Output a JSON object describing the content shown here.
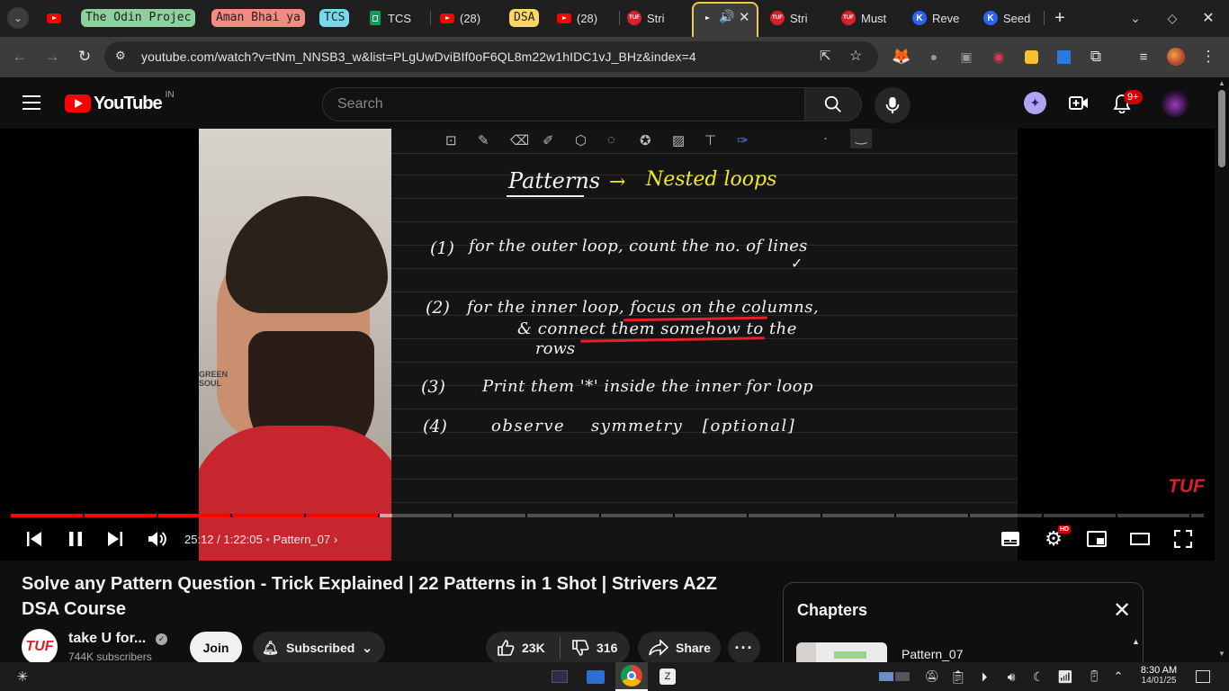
{
  "browser": {
    "tabs": [
      {
        "label": "",
        "icon": "youtube-icon"
      },
      {
        "label": "The Odin Projec",
        "group": true,
        "color": "#8fd19e"
      },
      {
        "label": "Aman Bhai ya",
        "group": true,
        "color": "#f28b82"
      },
      {
        "label": "TCS",
        "group": true,
        "color": "#78d9ec"
      },
      {
        "label": "TCS",
        "icon": "sheets-icon"
      },
      {
        "label": "(28)",
        "icon": "youtube-icon"
      },
      {
        "label": "DSA",
        "group": true,
        "color": "#fdd663"
      },
      {
        "label": "(28)",
        "icon": "youtube-icon"
      },
      {
        "label": "Stri",
        "icon": "tuf-icon"
      },
      {
        "label": "",
        "icon": "youtube-icon",
        "active": true
      },
      {
        "label": "Stri",
        "icon": "tuf-icon"
      },
      {
        "label": "Must",
        "icon": "tuf-icon"
      },
      {
        "label": "Reve",
        "icon": "k-icon"
      },
      {
        "label": "Seed",
        "icon": "k-icon"
      }
    ],
    "url": "youtube.com/watch?v=tNm_NNSB3_w&list=PLgUwDviBIf0oF6QL8m22w1hIDC1vJ_BHz&index=4"
  },
  "youtube": {
    "logo_text": "YouTube",
    "country_code": "IN",
    "search_placeholder": "Search",
    "notification_count": "9+"
  },
  "board": {
    "heading": "Patterns",
    "heading_arrow": "→",
    "heading_target": "Nested loops",
    "lines": [
      {
        "num": "(1)",
        "text": "for the outer loop, count the no. of lines"
      },
      {
        "num": "(2)",
        "text": "for the inner loop, focus on the columns,"
      },
      {
        "num": "",
        "text": "& connect them somehow to the"
      },
      {
        "num": "",
        "text": "rows"
      },
      {
        "num": "(3)",
        "text": "Print them '*' inside the inner for loop"
      },
      {
        "num": "(4)",
        "text": "observe    symmetry   [optional]"
      }
    ],
    "watermark": "TUF",
    "cam_text": "GREEN SOUL"
  },
  "player": {
    "progress": 0.309,
    "buffered": 0.32,
    "time": "25:12 / 1:22:05",
    "chapter": "Pattern_07",
    "hd_badge": "HD"
  },
  "video": {
    "title": "Solve any Pattern Question - Trick Explained | 22 Patterns in 1 Shot | Strivers A2Z DSA Course",
    "channel": "take U for...",
    "subscribers": "744K subscribers",
    "join_label": "Join",
    "subscribed_label": "Subscribed",
    "likes": "23K",
    "dislikes": "316",
    "share_label": "Share"
  },
  "chapters": {
    "heading": "Chapters",
    "item": "Pattern_07"
  },
  "taskbar": {
    "time": "8:30 AM",
    "date": "14/01/25"
  }
}
